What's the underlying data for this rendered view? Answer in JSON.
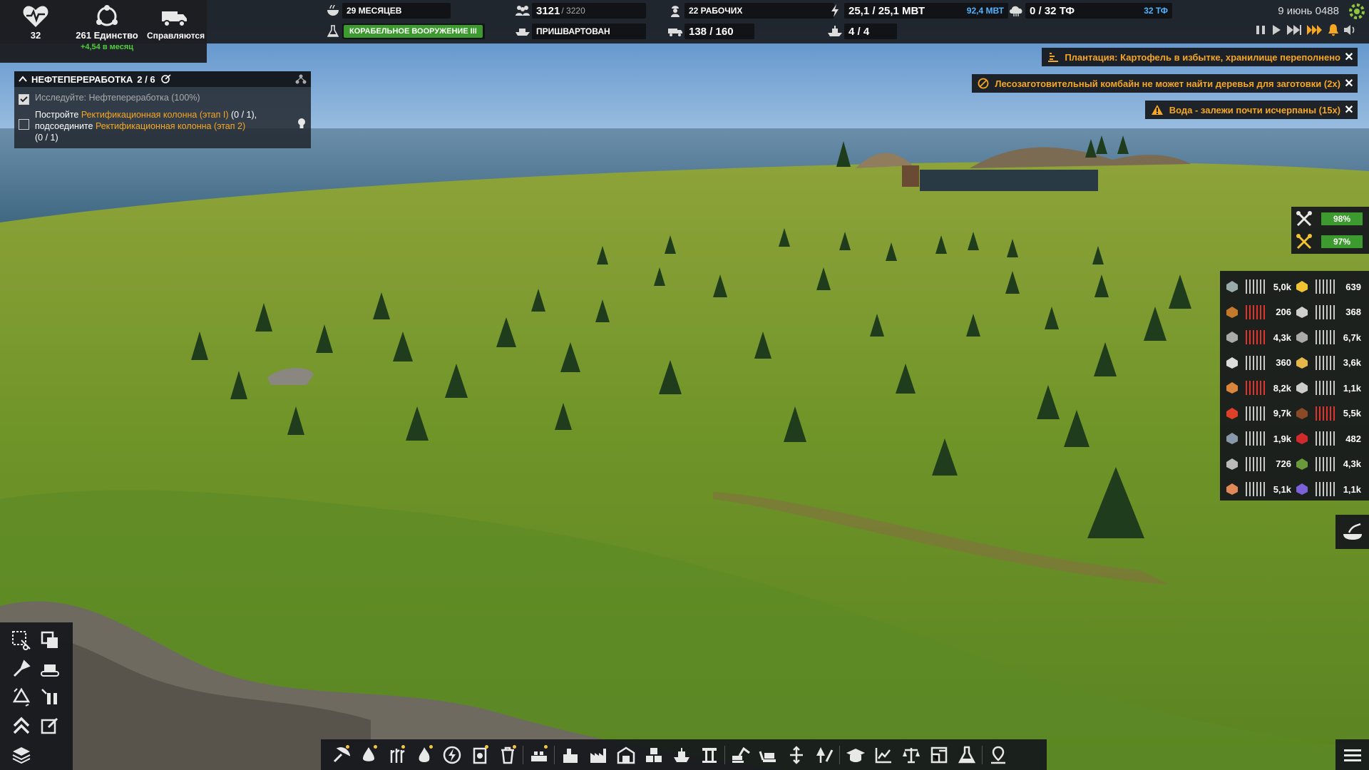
{
  "hud": {
    "health": "32",
    "unity": "261 Единство",
    "unity_rate": "+4,54 в месяц",
    "status": "Справляются"
  },
  "topbar": {
    "food_months": "29 МЕСЯЦЕВ",
    "population": "3121",
    "population_cap": "/ 3220",
    "workers": "22 РАБОЧИХ",
    "power": "25,1 / 25,1 МВТ",
    "power_extra": "92,4 МВТ",
    "computing": "0 / 32 ТФ",
    "computing_extra": "32 ТФ",
    "research": "КОРАБЕЛЬНОЕ ВООРУЖЕНИЕ III",
    "ship": "ПРИШВАРТОВАН",
    "vehicles": "138 / 160",
    "ships_count": "4 / 4",
    "date": "9 июнь 0488"
  },
  "quest": {
    "title": "НЕФТЕПЕРЕРАБОТКА",
    "progress": "2 / 6",
    "task1": "Исследуйте: Нефтепереработка (100%)",
    "task2_a": "Постройте ",
    "task2_b": "Ректификационная колонна (этап I)",
    "task2_c": " (0 / 1),",
    "task2_d": "подсоедините ",
    "task2_e": "Ректификационная колонна (этап 2)",
    "task2_f": "(0 / 1)"
  },
  "notifications": [
    "Плантация: Картофель в избытке, хранилище переполнено",
    "Лесозаготовительный комбайн не может найти деревья для заготовки (2x)",
    "Вода - залежи почти исчерпаны (15x)"
  ],
  "maintenance": [
    "98%",
    "97%"
  ],
  "resources": {
    "left": [
      "5,0k",
      "206",
      "4,3k",
      "360",
      "8,2k",
      "9,7k",
      "1,9k",
      "726",
      "5,1k"
    ],
    "right": [
      "639",
      "368",
      "6,7k",
      "3,6k",
      "1,1k",
      "5,5k",
      "482",
      "4,3k",
      "1,1k"
    ],
    "left_red": [
      false,
      true,
      true,
      false,
      true,
      false,
      false,
      false,
      false
    ],
    "right_red": [
      false,
      false,
      false,
      false,
      false,
      true,
      false,
      false,
      false
    ],
    "left_colors": [
      "#9aa",
      "#c47a2c",
      "#aaa",
      "#ddd",
      "#d9853b",
      "#e0402a",
      "#8899aa",
      "#bbb",
      "#e08a5a"
    ],
    "right_colors": [
      "#f1c232",
      "#cfcfcf",
      "#aaa",
      "#e6b84a",
      "#ccc",
      "#8a4a26",
      "#d02b2b",
      "#6a9a3a",
      "#7b62d9"
    ]
  },
  "colors": {
    "accent_orange": "#f5a623",
    "accent_green": "#3d9a2f",
    "accent_red": "#e0342f",
    "accent_blue": "#4fb3ff"
  }
}
